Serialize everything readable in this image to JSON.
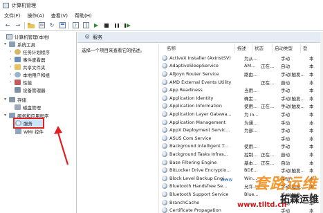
{
  "window": {
    "title": "计算机管理"
  },
  "menu": [
    "文件(F)",
    "操作(A)",
    "查看(V)",
    "帮助(H)"
  ],
  "toolbar": {
    "icons": [
      "back-arrow-icon",
      "forward-arrow-icon",
      "folder-icon",
      "properties-icon",
      "refresh-icon",
      "export-icon",
      "help-icon",
      "details-view-icon",
      "play-icon",
      "stop-icon",
      "pause-icon",
      "restart-icon"
    ]
  },
  "tree": {
    "items": [
      {
        "label": "计算机管理(本地)",
        "indent": 0,
        "arrow": ""
      },
      {
        "label": "系统工具",
        "indent": 1,
        "arrow": "▾"
      },
      {
        "label": "任务计划程序",
        "indent": 2,
        "arrow": "›"
      },
      {
        "label": "事件查看器",
        "indent": 2,
        "arrow": "›"
      },
      {
        "label": "共享文件夹",
        "indent": 2,
        "arrow": "›"
      },
      {
        "label": "本地用户和组",
        "indent": 2,
        "arrow": "›"
      },
      {
        "label": "性能",
        "indent": 2,
        "arrow": "›"
      },
      {
        "label": "设备管理器",
        "indent": 2,
        "arrow": ""
      },
      {
        "label": "存储",
        "indent": 1,
        "arrow": "▾"
      },
      {
        "label": "磁盘管理",
        "indent": 2,
        "arrow": ""
      },
      {
        "label": "服务和应用程序",
        "indent": 1,
        "arrow": "▾"
      },
      {
        "label": "服务",
        "indent": 2,
        "arrow": ""
      },
      {
        "label": "WMI 控件",
        "indent": 2,
        "arrow": ""
      }
    ]
  },
  "main": {
    "header": "服务",
    "description_hint": "选择一个项目来查看它的描述。",
    "columns": [
      "名称",
      "描述",
      "状态",
      "启动类型",
      "登"
    ],
    "rows": [
      [
        "ActiveX Installer (AxInstSV)",
        "为从...",
        "",
        "手动",
        "本"
      ],
      [
        "AdaptiveSleepService",
        "AM...",
        "正在...",
        "自动",
        "本"
      ],
      [
        "AllJoyn Router Service",
        "路由...",
        "",
        "手动(触发...",
        "本"
      ],
      [
        "AMD External Events Utility",
        "",
        "正在...",
        "自动",
        "本"
      ],
      [
        "App Readiness",
        "当用...",
        "",
        "手动",
        "本"
      ],
      [
        "Application Identity",
        "确定...",
        "",
        "手动(触发...",
        "本"
      ],
      [
        "Application Information",
        "使用...",
        "正在...",
        "手动(触发...",
        "本"
      ],
      [
        "Application Layer Gatewa...",
        "为 In...",
        "",
        "手动",
        "本"
      ],
      [
        "Application Management",
        "为通...",
        "",
        "手动",
        "本"
      ],
      [
        "AppX Deployment Servic...",
        "为部...",
        "",
        "手动",
        "本"
      ],
      [
        "ASUS Com Service",
        "",
        "",
        "手动",
        "本"
      ],
      [
        "Background Intelligent T...",
        "使用...",
        "",
        "手动",
        "本"
      ],
      [
        "Background Tasks Infras...",
        "控制...",
        "正在...",
        "自动",
        "本"
      ],
      [
        "Base Filtering Engine",
        "基本...",
        "正在...",
        "自动",
        "本"
      ],
      [
        "BitLocker Drive Encryptio...",
        "BDE...",
        "",
        "手动(触发...",
        "本"
      ],
      [
        "Block Level Backup Engi...",
        "Win...",
        "",
        "手动",
        "本"
      ],
      [
        "Bluetooth Handsfree Se...",
        "允许...",
        "",
        "手动(触发...",
        "本"
      ],
      [
        "Bluetooth Support Service",
        "Blue...",
        "",
        "手动(触发...",
        "本"
      ],
      [
        "BranchCache",
        "",
        "",
        "手动",
        "本"
      ],
      [
        "Certificate Propagation",
        "",
        "",
        "手动",
        "本"
      ]
    ]
  },
  "watermark": {
    "line1": "套路运维",
    "www": "www",
    "line2": "拓霖运维",
    "url": "www.tlltd.cn"
  },
  "colors": {
    "selection": "#cce4f7",
    "highlight_box": "#e02020",
    "header_bg": "#e6ecf4"
  }
}
